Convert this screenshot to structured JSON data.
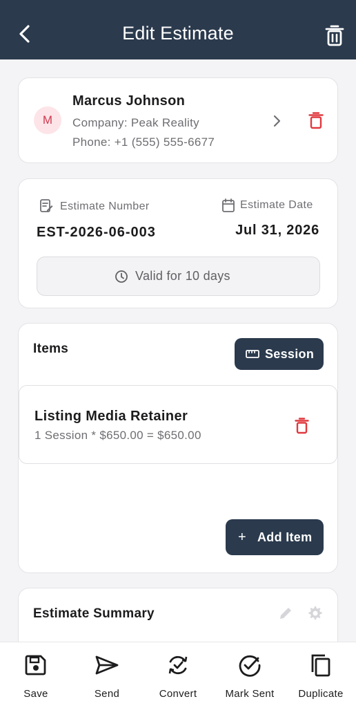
{
  "header": {
    "title": "Edit Estimate"
  },
  "client": {
    "initial": "M",
    "name": "Marcus Johnson",
    "company": "Company: Peak Reality",
    "phone": "Phone: +1 (555) 555-6677"
  },
  "estimate": {
    "number_label": "Estimate Number",
    "number": "EST-2026-06-003",
    "date_label": "Estimate Date",
    "date": "Jul 31, 2026",
    "validity": "Valid for 10 days"
  },
  "items": {
    "title": "Items",
    "unit_button": "Session",
    "list": [
      {
        "name": "Listing Media Retainer",
        "detail": "1 Session * $650.00 = $650.00"
      }
    ],
    "add_button": "Add Item"
  },
  "summary": {
    "title": "Estimate Summary"
  },
  "bottom_nav": [
    {
      "label": "Save",
      "icon": "save-icon"
    },
    {
      "label": "Send",
      "icon": "send-icon"
    },
    {
      "label": "Convert",
      "icon": "convert-icon"
    },
    {
      "label": "Mark Sent",
      "icon": "check-circle-icon"
    },
    {
      "label": "Duplicate",
      "icon": "copy-icon"
    }
  ],
  "colors": {
    "header": "#2b3a4d",
    "danger": "#e0393e",
    "avatar_bg": "#fde4e8",
    "avatar_text": "#d0394f"
  }
}
